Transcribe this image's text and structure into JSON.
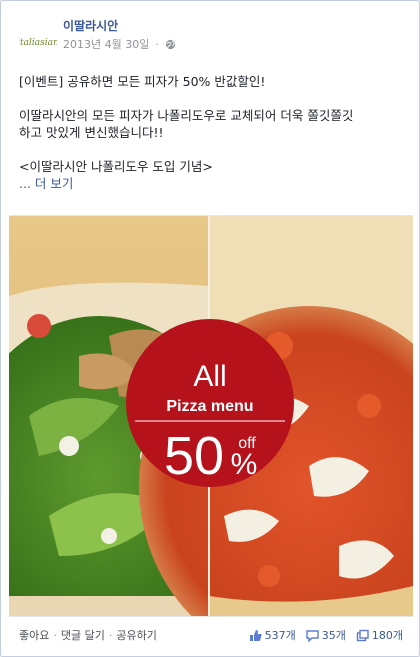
{
  "post": {
    "page_name": "이딸라시안",
    "date": "2013년 4월 30일",
    "privacy_icon": "globe-icon",
    "avatar_logo_text": "italiasian",
    "text": {
      "line1": "[이벤트] 공유하면 모든 피자가 50% 반값할인!",
      "line2": "이딸라시안의 모든 피자가 나폴리도우로 교체되어 더욱 쫄깃쫄깃",
      "line3": "하고 맛있게 변신했습니다!!",
      "line4": "<이딸라시안 나폴리도우 도입 기념>",
      "more": "... 더 보기"
    },
    "image": {
      "badge_all": "All",
      "badge_menu": "Pizza menu",
      "badge_percent": "50",
      "badge_percent_sign": "%",
      "badge_off": "off",
      "badge_color": "#b5121b"
    }
  },
  "footer": {
    "like": "좋아요",
    "comment": "댓글 달기",
    "share": "공유하기",
    "likes_count": "537개",
    "comments_count": "35개",
    "shares_count": "180개"
  }
}
